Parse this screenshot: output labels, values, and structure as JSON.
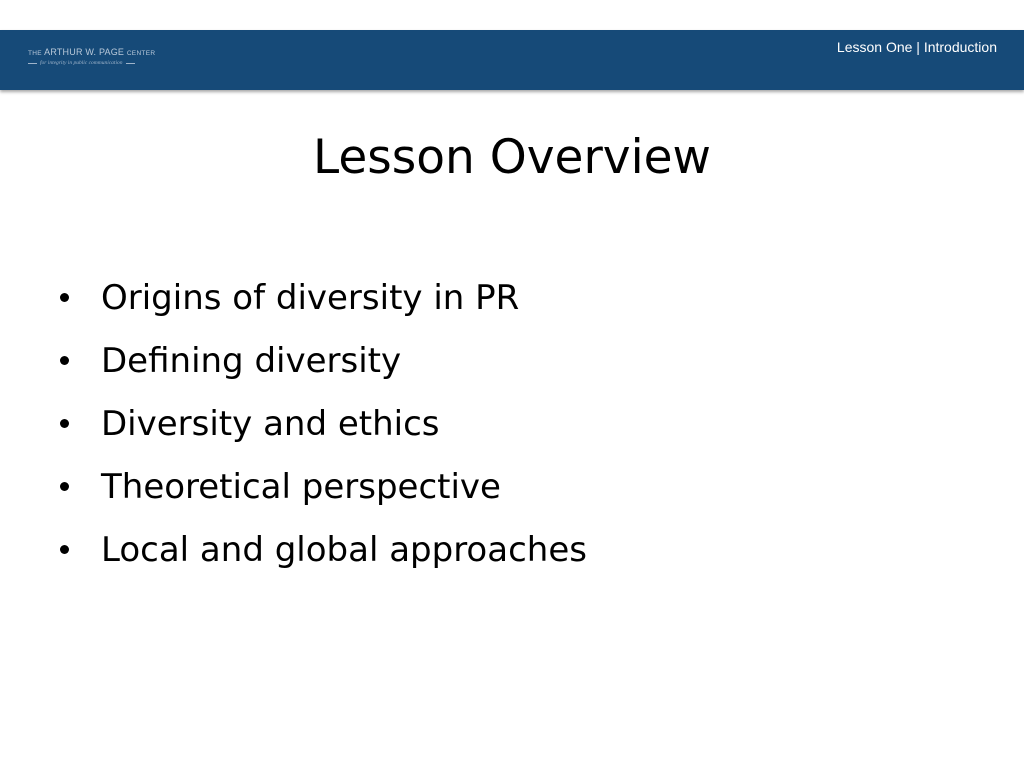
{
  "header": {
    "logo_prefix": "THE",
    "logo_name": "ARTHUR W. PAGE",
    "logo_suffix": "CENTER",
    "logo_tagline": "for integrity in public communication",
    "section_label": "Lesson One | Introduction",
    "bar_color": "#164a78"
  },
  "slide": {
    "title": "Lesson Overview",
    "bullets": [
      "Origins of diversity in PR",
      "Defining diversity",
      "Diversity and ethics",
      "Theoretical perspective",
      "Local and global approaches"
    ]
  }
}
